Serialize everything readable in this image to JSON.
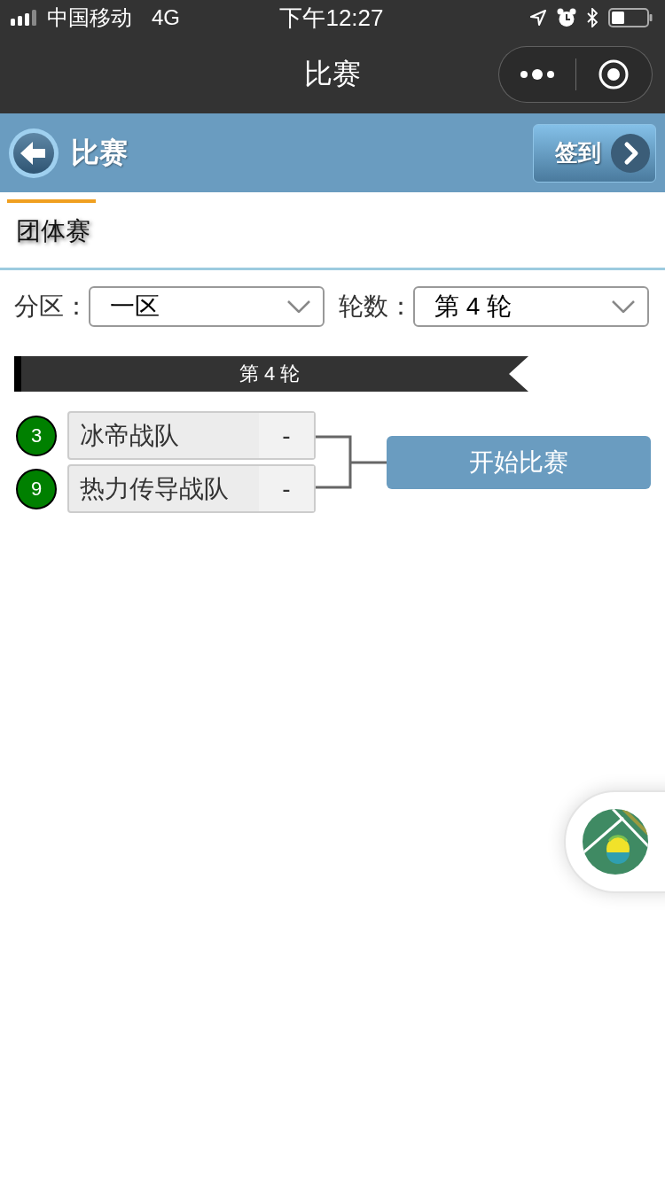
{
  "status_bar": {
    "carrier": "中国移动",
    "network": "4G",
    "time": "下午12:27"
  },
  "nav_bar": {
    "title": "比赛"
  },
  "header": {
    "title": "比赛",
    "checkin_button": "签到"
  },
  "tabs": [
    {
      "label": "团体赛",
      "selected": true
    }
  ],
  "filters": [
    {
      "label": "分区：",
      "value": "一区"
    },
    {
      "label": "轮数：",
      "value": "第 4 轮"
    }
  ],
  "round": {
    "title": "第 4 轮"
  },
  "match": {
    "teams": [
      {
        "seed": "3",
        "name": "冰帝战队",
        "score": "-"
      },
      {
        "seed": "9",
        "name": "热力传导战队",
        "score": "-"
      }
    ],
    "action_button": "开始比赛"
  }
}
